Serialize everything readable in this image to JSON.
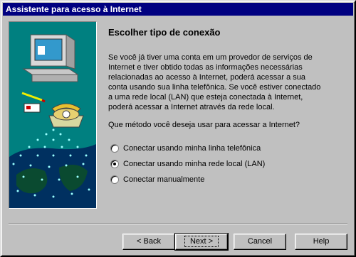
{
  "window": {
    "title": "Assistente para acesso à Internet"
  },
  "main": {
    "heading": "Escolher tipo de conexão",
    "paragraph": "Se você já tiver uma conta em um provedor de serviços de Internet e tiver obtido todas as informações necessárias relacionadas ao acesso à Internet, poderá acessar a sua conta usando sua linha telefônica. Se você estiver conectado a uma rede local (LAN) que esteja conectada à Internet, poderá acessar a Internet através da rede local.",
    "question": "Que método você deseja usar para acessar a Internet?",
    "options": [
      {
        "label": "Conectar usando minha linha telefônica",
        "selected": false
      },
      {
        "label": "Conectar usando minha rede local (LAN)",
        "selected": true
      },
      {
        "label": "Conectar manualmente",
        "selected": false
      }
    ]
  },
  "buttons": {
    "back": "< Back",
    "next": "Next >",
    "cancel": "Cancel",
    "help": "Help"
  },
  "colors": {
    "titlebar": "#000080",
    "face": "#c0c0c0",
    "illustration_bg": "#008080"
  },
  "icons": [
    "computer-icon",
    "telephone-icon",
    "pencil-icon",
    "envelope-icon",
    "globe-network-icon"
  ]
}
